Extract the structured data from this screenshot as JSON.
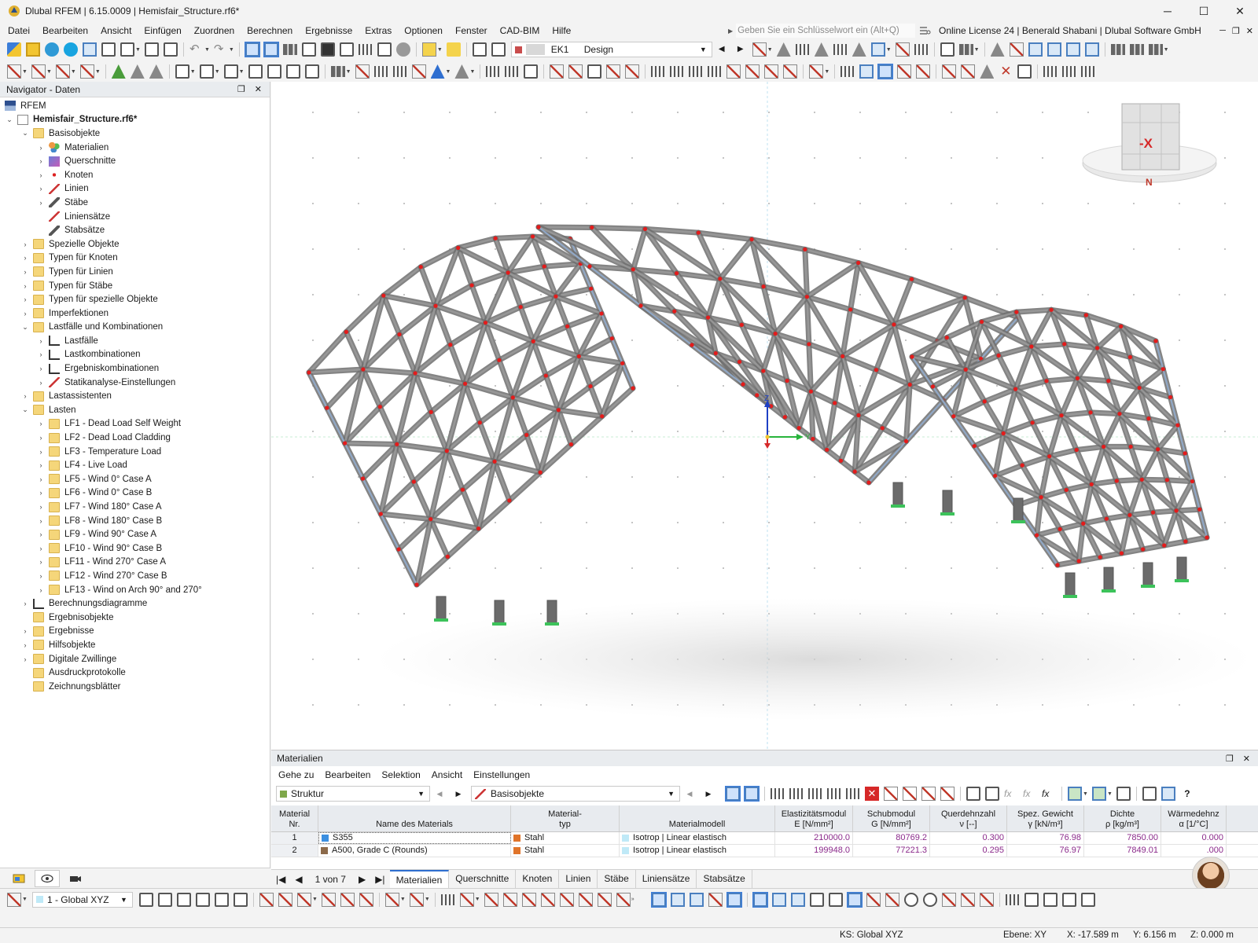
{
  "window": {
    "title": "Dlubal RFEM | 6.15.0009 | Hemisfair_Structure.rf6*",
    "minimize": "─",
    "maximize": "☐",
    "close": "✕"
  },
  "menu": {
    "items": [
      "Datei",
      "Bearbeiten",
      "Ansicht",
      "Einfügen",
      "Zuordnen",
      "Berechnen",
      "Ergebnisse",
      "Extras",
      "Optionen",
      "Fenster",
      "CAD-BIM",
      "Hilfe"
    ],
    "search_placeholder": "Geben Sie ein Schlüsselwort ein (Alt+Q)",
    "license": "Online License 24 | Benerald Shabani | Dlubal Software GmbH"
  },
  "toolbar": {
    "load_combo": {
      "code": "EK1",
      "value": "Design",
      "color": "#c94c4c"
    }
  },
  "navigator": {
    "title": "Navigator - Daten",
    "root": "RFEM",
    "file": "Hemisfair_Structure.rf6*",
    "basis": "Basisobjekte",
    "basis_items": [
      "Materialien",
      "Querschnitte",
      "Knoten",
      "Linien",
      "Stäbe",
      "Liniensätze",
      "Stabsätze"
    ],
    "groups1": [
      "Spezielle Objekte",
      "Typen für Knoten",
      "Typen für Linien",
      "Typen für Stäbe",
      "Typen für spezielle Objekte",
      "Imperfektionen"
    ],
    "lastfaelle": "Lastfälle und Kombinationen",
    "lastfaelle_items": [
      "Lastfälle",
      "Lastkombinationen",
      "Ergebniskombinationen",
      "Statikanalyse-Einstellungen"
    ],
    "lastassistenten": "Lastassistenten",
    "lasten": "Lasten",
    "load_cases": [
      "LF1 - Dead Load Self Weight",
      "LF2 - Dead Load Cladding",
      "LF3 - Temperature Load",
      "LF4 - Live Load",
      "LF5 - Wind 0° Case A",
      "LF6 - Wind 0° Case B",
      "LF7 - Wind 180° Case A",
      "LF8 - Wind 180° Case B",
      "LF9 - Wind 90° Case A",
      "LF10 - Wind 90° Case B",
      "LF11 - Wind 270° Case A",
      "LF12 - Wind 270° Case B",
      "LF13 - Wind on Arch 90° and 270°"
    ],
    "groups2": [
      "Berechnungsdiagramme",
      "Ergebnisobjekte",
      "Ergebnisse",
      "Hilfsobjekte",
      "Digitale Zwillinge",
      "Ausdruckprotokolle",
      "Zeichnungsblätter"
    ]
  },
  "viewport": {
    "view_cube_label": "-X",
    "compass_label": "N",
    "axis_z": "Z",
    "axis_y": "Y"
  },
  "materials_panel": {
    "title": "Materialien",
    "menu": [
      "Gehe zu",
      "Bearbeiten",
      "Selektion",
      "Ansicht",
      "Einstellungen"
    ],
    "combo_structure": "Struktur",
    "combo_objects": "Basisobjekte",
    "columns": [
      {
        "l1": "Material",
        "l2": "Nr."
      },
      {
        "l1": "",
        "l2": "Name des Materials"
      },
      {
        "l1": "Material-",
        "l2": "typ"
      },
      {
        "l1": "",
        "l2": "Materialmodell"
      },
      {
        "l1": "Elastizitätsmodul",
        "l2": "E [N/mm²]"
      },
      {
        "l1": "Schubmodul",
        "l2": "G [N/mm²]"
      },
      {
        "l1": "Querdehnzahl",
        "l2": "ν [--]"
      },
      {
        "l1": "Spez. Gewicht",
        "l2": "γ [kN/m³]"
      },
      {
        "l1": "Dichte",
        "l2": "ρ [kg/m³]"
      },
      {
        "l1": "Wärmedehnz",
        "l2": "α [1/°C]"
      }
    ],
    "rows": [
      {
        "nr": "1",
        "name": "S355",
        "name_color": "#3b8fe0",
        "type": "Stahl",
        "type_color": "#e0742a",
        "model": "Isotrop | Linear elastisch",
        "model_color": "#bfe9f7",
        "E": "210000.0",
        "G": "80769.2",
        "nu": "0.300",
        "gamma": "76.98",
        "rho": "7850.00",
        "alpha": "0.000"
      },
      {
        "nr": "2",
        "name": "A500, Grade C (Rounds)",
        "name_color": "#8c6a4a",
        "type": "Stahl",
        "type_color": "#e0742a",
        "model": "Isotrop | Linear elastisch",
        "model_color": "#bfe9f7",
        "E": "199948.0",
        "G": "77221.3",
        "nu": "0.295",
        "gamma": "76.97",
        "rho": "7849.01",
        "alpha": ".000"
      }
    ],
    "pager": "1 von 7",
    "tabs": [
      "Materialien",
      "Querschnitte",
      "Knoten",
      "Linien",
      "Stäbe",
      "Liniensätze",
      "Stabsätze"
    ]
  },
  "bottom_toolbar": {
    "view_combo": "1 - Global XYZ"
  },
  "statusbar": {
    "ks": "KS: Global XYZ",
    "ebene": "Ebene: XY",
    "x": "X: -17.589 m",
    "y": "Y: 6.156 m",
    "z": "Z: 0.000 m"
  }
}
